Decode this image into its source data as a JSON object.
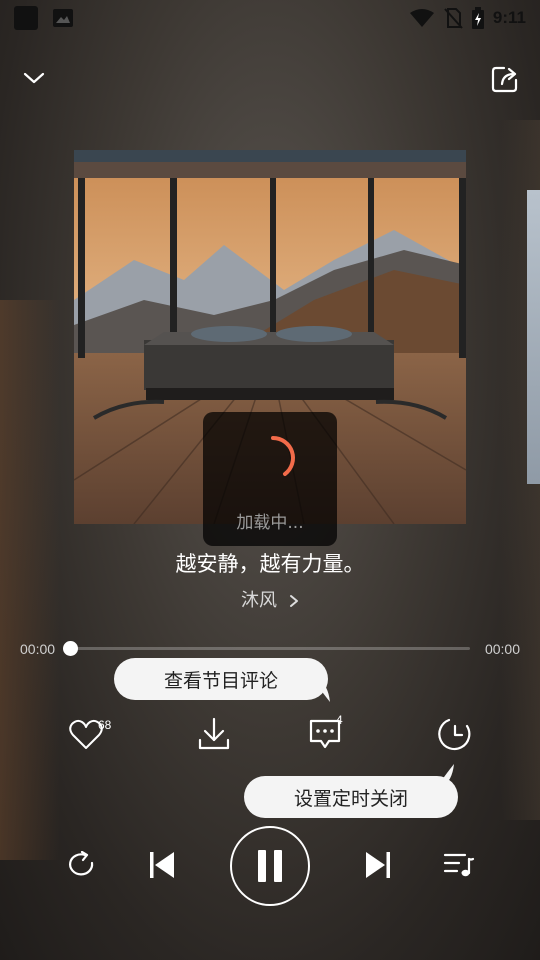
{
  "status_bar": {
    "time": "9:11"
  },
  "loading": {
    "text": "加载中..."
  },
  "track": {
    "title": "越安静，越有力量。",
    "artist": "沐风"
  },
  "progress": {
    "current": "00:00",
    "total": "00:00",
    "fraction": 0
  },
  "tooltips": {
    "comments": "查看节目评论",
    "timer": "设置定时关闭"
  },
  "actions": {
    "like_count": "68",
    "comment_count": "4"
  },
  "icons": {
    "collapse": "chevron-down-icon",
    "share": "share-icon",
    "like": "heart-icon",
    "download": "download-icon",
    "comment": "comment-icon",
    "timer": "clock-icon",
    "repeat": "repeat-icon",
    "prev": "previous-icon",
    "play": "pause-icon",
    "next": "next-icon",
    "playlist": "playlist-icon"
  },
  "colors": {
    "accent": "#f26b4a",
    "tooltip_bg": "#f4f4f4"
  }
}
